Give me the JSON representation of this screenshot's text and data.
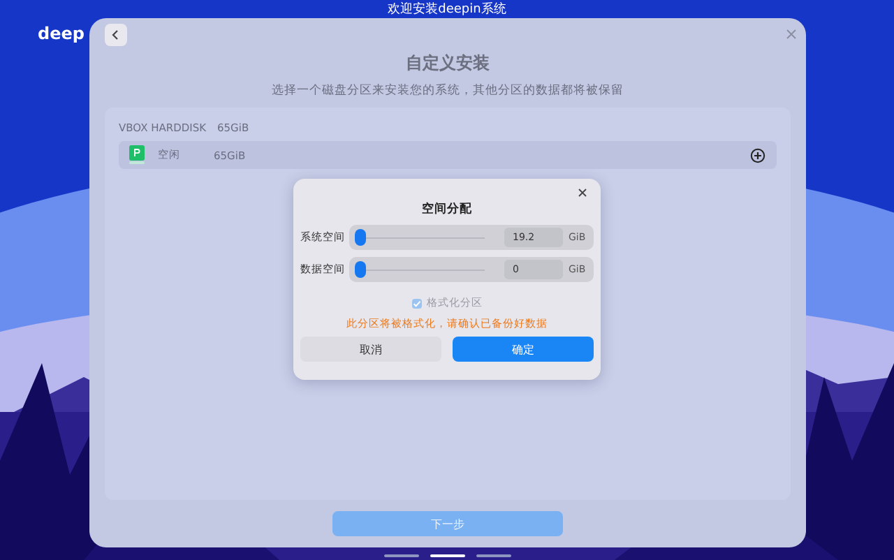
{
  "desktop": {
    "title": "欢迎安装deepin系统",
    "logo": "deep"
  },
  "window": {
    "heading": "自定义安装",
    "subtitle": "选择一个磁盘分区来安装您的系统，其他分区的数据都将被保留",
    "disk": {
      "name": "VBOX HARDDISK",
      "size": "65GiB"
    },
    "partitions": [
      {
        "label": "空闲",
        "size": "65GiB"
      }
    ],
    "next_button": "下一步"
  },
  "dialog": {
    "title": "空间分配",
    "rows": [
      {
        "label": "系统空间",
        "level": 0,
        "value": "19.2",
        "unit": "GiB"
      },
      {
        "label": "数据空间",
        "level": 0,
        "value": "0",
        "unit": "GiB"
      }
    ],
    "format": {
      "label": "格式化分区",
      "checked": true,
      "disabled": true
    },
    "warning": "此分区将被格式化，请确认已备份好数据",
    "buttons": [
      {
        "label": "取消",
        "kind": "secondary"
      },
      {
        "label": "确定",
        "kind": "primary"
      }
    ]
  },
  "pager": [
    {
      "selected": false
    },
    {
      "selected": true
    },
    {
      "selected": false
    }
  ]
}
